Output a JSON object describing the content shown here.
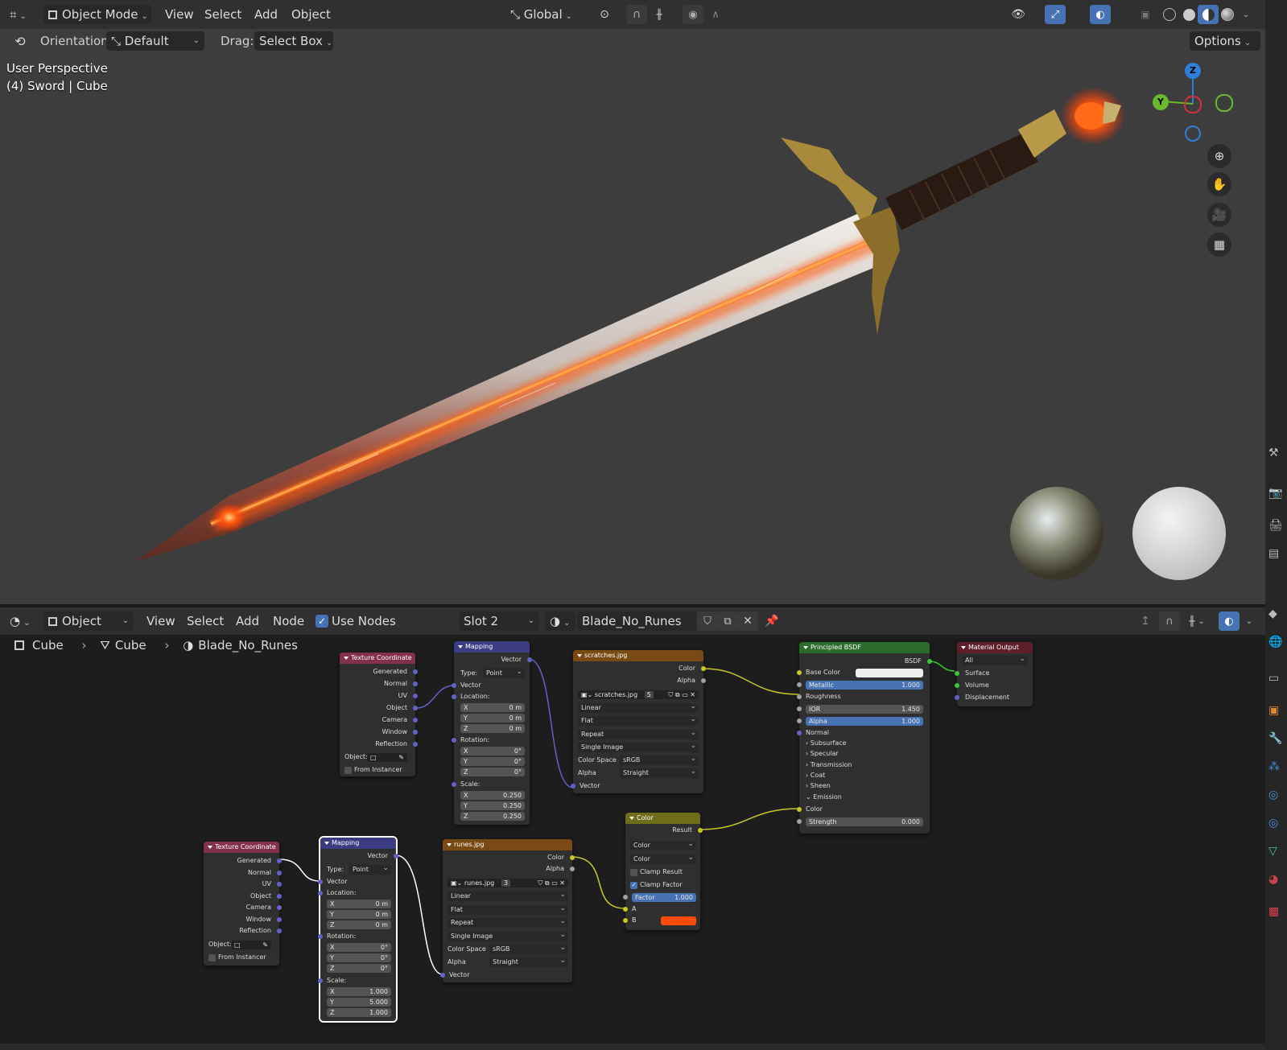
{
  "top_toolbar": {
    "mode": "Object Mode",
    "menus": [
      "View",
      "Select",
      "Add",
      "Object"
    ],
    "transform_orientation": "Global",
    "options_label": "Options"
  },
  "tool_settings": {
    "orientation_label": "Orientation:",
    "orientation_value": "Default",
    "drag_label": "Drag:",
    "drag_value": "Select Box"
  },
  "viewport": {
    "overlay_line1": "User Perspective",
    "overlay_line2": "(4) Sword | Cube",
    "gizmo_labels": {
      "z": "Z",
      "y": "Y"
    }
  },
  "node_header": {
    "editor_mode": "Object",
    "menus": [
      "View",
      "Select",
      "Add",
      "Node"
    ],
    "use_nodes_label": "Use Nodes",
    "slot": "Slot 2",
    "material": "Blade_No_Runes"
  },
  "breadcrumb": [
    "Cube",
    "Cube",
    "Blade_No_Runes"
  ],
  "nodes": {
    "texcoord1": {
      "title": "Texture Coordinate",
      "outputs": [
        "Generated",
        "Normal",
        "UV",
        "Object",
        "Camera",
        "Window",
        "Reflection"
      ],
      "object_label": "Object:",
      "from_instancer": "From Instancer"
    },
    "mapping1": {
      "title": "Mapping",
      "out_vector": "Vector",
      "type_label": "Type:",
      "type_value": "Point",
      "in_vector": "Vector",
      "location_label": "Location:",
      "location": [
        {
          "axis": "X",
          "value": "0 m"
        },
        {
          "axis": "Y",
          "value": "0 m"
        },
        {
          "axis": "Z",
          "value": "0 m"
        }
      ],
      "rotation_label": "Rotation:",
      "rotation": [
        {
          "axis": "X",
          "value": "0°"
        },
        {
          "axis": "Y",
          "value": "0°"
        },
        {
          "axis": "Z",
          "value": "0°"
        }
      ],
      "scale_label": "Scale:",
      "scale": [
        {
          "axis": "X",
          "value": "0.250"
        },
        {
          "axis": "Y",
          "value": "0.250"
        },
        {
          "axis": "Z",
          "value": "0.250"
        }
      ]
    },
    "scratches": {
      "title": "scratches.jpg",
      "out_color": "Color",
      "out_alpha": "Alpha",
      "image_name": "scratches.jpg",
      "users": "5",
      "interpolation": "Linear",
      "projection": "Flat",
      "extension": "Repeat",
      "source": "Single Image",
      "color_space_label": "Color Space",
      "color_space": "sRGB",
      "alpha_label": "Alpha",
      "alpha_mode": "Straight",
      "in_vector": "Vector"
    },
    "bsdf": {
      "title": "Principled BSDF",
      "out_bsdf": "BSDF",
      "base_color_label": "Base Color",
      "base_color": "#eeeeee",
      "metallic_label": "Metallic",
      "metallic": "1.000",
      "roughness_label": "Roughness",
      "ior_label": "IOR",
      "ior": "1.450",
      "alpha_label": "Alpha",
      "alpha": "1.000",
      "normal_label": "Normal",
      "panels": [
        "Subsurface",
        "Specular",
        "Transmission",
        "Coat",
        "Sheen"
      ],
      "emission_label": "Emission",
      "emission_color_label": "Color",
      "strength_label": "Strength",
      "strength": "0.000"
    },
    "output": {
      "title": "Material Output",
      "target": "All",
      "inputs": [
        "Surface",
        "Volume",
        "Displacement"
      ]
    },
    "color_mix": {
      "title": "Color",
      "out_result": "Result",
      "blend_type": "Color",
      "data_type": "Color",
      "clamp_result": "Clamp Result",
      "clamp_factor": "Clamp Factor",
      "factor_label": "Factor",
      "factor": "1.000",
      "a_label": "A",
      "b_label": "B",
      "b_color": "#ff4a0a"
    },
    "texcoord2": {
      "title": "Texture Coordinate",
      "outputs": [
        "Generated",
        "Normal",
        "UV",
        "Object",
        "Camera",
        "Window",
        "Reflection"
      ],
      "object_label": "Object:",
      "from_instancer": "From Instancer"
    },
    "mapping2": {
      "title": "Mapping",
      "out_vector": "Vector",
      "type_label": "Type:",
      "type_value": "Point",
      "in_vector": "Vector",
      "location_label": "Location:",
      "location": [
        {
          "axis": "X",
          "value": "0 m"
        },
        {
          "axis": "Y",
          "value": "0 m"
        },
        {
          "axis": "Z",
          "value": "0 m"
        }
      ],
      "rotation_label": "Rotation:",
      "rotation": [
        {
          "axis": "X",
          "value": "0°"
        },
        {
          "axis": "Y",
          "value": "0°"
        },
        {
          "axis": "Z",
          "value": "0°"
        }
      ],
      "scale_label": "Scale:",
      "scale": [
        {
          "axis": "X",
          "value": "1.000"
        },
        {
          "axis": "Y",
          "value": "5.000"
        },
        {
          "axis": "Z",
          "value": "1.000"
        }
      ]
    },
    "runes": {
      "title": "runes.jpg",
      "out_color": "Color",
      "out_alpha": "Alpha",
      "image_name": "runes.jpg",
      "users": "3",
      "interpolation": "Linear",
      "projection": "Flat",
      "extension": "Repeat",
      "source": "Single Image",
      "color_space_label": "Color Space",
      "color_space": "sRGB",
      "alpha_label": "Alpha",
      "alpha_mode": "Straight",
      "in_vector": "Vector"
    }
  },
  "colors": {
    "accent_blue": "#4772b3",
    "texcoord_header": "#83314a",
    "mapping_header": "#3c3c83",
    "image_header": "#7a4a14",
    "shader_header": "#2b6b2b",
    "output_header": "#5e1e2a",
    "color_header": "#6e6e1a"
  },
  "icons": [
    "editor-type-icon",
    "object-mode-icon",
    "transform-icon",
    "snap-icon",
    "proportional-icon",
    "visibility-icon",
    "gizmo-icon",
    "overlay-icon",
    "shading-wireframe-icon",
    "shading-solid-icon",
    "shading-material-icon",
    "shading-rendered-icon",
    "zoom-icon",
    "hand-icon",
    "camera-icon",
    "grid-icon",
    "pin-icon",
    "shield-icon",
    "duplicate-icon",
    "close-icon",
    "material-icon",
    "mesh-icon",
    "object-icon"
  ]
}
